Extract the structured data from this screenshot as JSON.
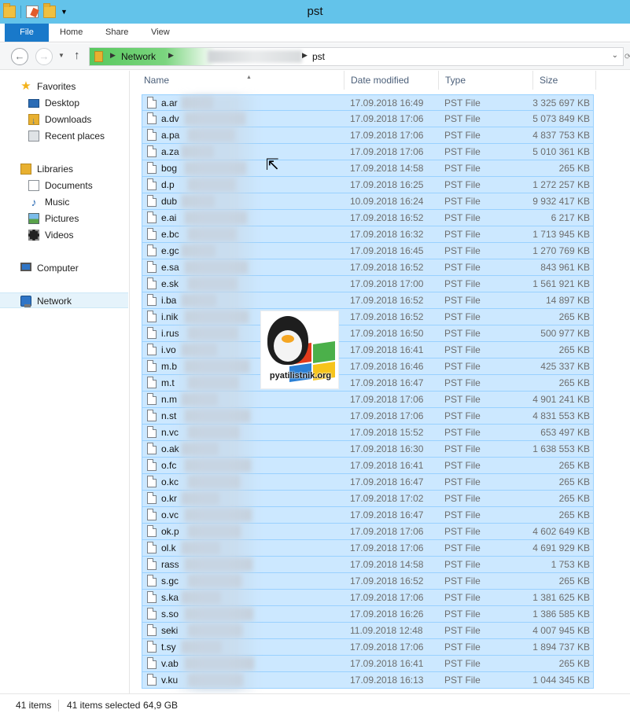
{
  "window": {
    "title": "pst"
  },
  "ribbon": {
    "tabs": [
      "File",
      "Home",
      "Share",
      "View"
    ]
  },
  "address": {
    "segments": [
      "Network",
      "pst"
    ]
  },
  "navpane": {
    "favorites": {
      "label": "Favorites",
      "items": [
        "Desktop",
        "Downloads",
        "Recent places"
      ]
    },
    "libraries": {
      "label": "Libraries",
      "items": [
        "Documents",
        "Music",
        "Pictures",
        "Videos"
      ]
    },
    "computer": "Computer",
    "network": "Network"
  },
  "columns": {
    "name": "Name",
    "date": "Date modified",
    "type": "Type",
    "size": "Size"
  },
  "files": [
    {
      "name": "a.ar",
      "date": "17.09.2018 16:49",
      "type": "PST File",
      "size": "3 325 697 KB"
    },
    {
      "name": "a.dv",
      "date": "17.09.2018 17:06",
      "type": "PST File",
      "size": "5 073 849 KB"
    },
    {
      "name": "a.pa",
      "date": "17.09.2018 17:06",
      "type": "PST File",
      "size": "4 837 753 KB"
    },
    {
      "name": "a.za",
      "date": "17.09.2018 17:06",
      "type": "PST File",
      "size": "5 010 361 KB"
    },
    {
      "name": "bog",
      "date": "17.09.2018 14:58",
      "type": "PST File",
      "size": "265 KB"
    },
    {
      "name": "d.p",
      "date": "17.09.2018 16:25",
      "type": "PST File",
      "size": "1 272 257 KB"
    },
    {
      "name": "dub",
      "date": "10.09.2018 16:24",
      "type": "PST File",
      "size": "9 932 417 KB"
    },
    {
      "name": "e.ai",
      "date": "17.09.2018 16:52",
      "type": "PST File",
      "size": "6 217 KB"
    },
    {
      "name": "e.bc",
      "date": "17.09.2018 16:32",
      "type": "PST File",
      "size": "1 713 945 KB"
    },
    {
      "name": "e.gc",
      "date": "17.09.2018 16:45",
      "type": "PST File",
      "size": "1 270 769 KB"
    },
    {
      "name": "e.sa",
      "date": "17.09.2018 16:52",
      "type": "PST File",
      "size": "843 961 KB"
    },
    {
      "name": "e.sk",
      "date": "17.09.2018 17:00",
      "type": "PST File",
      "size": "1 561 921 KB"
    },
    {
      "name": "i.ba",
      "date": "17.09.2018 16:52",
      "type": "PST File",
      "size": "14 897 KB"
    },
    {
      "name": "i.nik",
      "date": "17.09.2018 16:52",
      "type": "PST File",
      "size": "265 KB"
    },
    {
      "name": "i.rus",
      "date": "17.09.2018 16:50",
      "type": "PST File",
      "size": "500 977 KB"
    },
    {
      "name": "i.vo",
      "date": "17.09.2018 16:41",
      "type": "PST File",
      "size": "265 KB"
    },
    {
      "name": "m.b",
      "date": "17.09.2018 16:46",
      "type": "PST File",
      "size": "425 337 KB"
    },
    {
      "name": "m.t",
      "date": "17.09.2018 16:47",
      "type": "PST File",
      "size": "265 KB"
    },
    {
      "name": "n.m",
      "date": "17.09.2018 17:06",
      "type": "PST File",
      "size": "4 901 241 KB"
    },
    {
      "name": "n.st",
      "date": "17.09.2018 17:06",
      "type": "PST File",
      "size": "4 831 553 KB"
    },
    {
      "name": "n.vc",
      "date": "17.09.2018 15:52",
      "type": "PST File",
      "size": "653 497 KB"
    },
    {
      "name": "o.ak",
      "date": "17.09.2018 16:30",
      "type": "PST File",
      "size": "1 638 553 KB"
    },
    {
      "name": "o.fc",
      "date": "17.09.2018 16:41",
      "type": "PST File",
      "size": "265 KB"
    },
    {
      "name": "o.kc",
      "date": "17.09.2018 16:47",
      "type": "PST File",
      "size": "265 KB"
    },
    {
      "name": "o.kr",
      "date": "17.09.2018 17:02",
      "type": "PST File",
      "size": "265 KB"
    },
    {
      "name": "o.vc",
      "date": "17.09.2018 16:47",
      "type": "PST File",
      "size": "265 KB"
    },
    {
      "name": "ok.p",
      "date": "17.09.2018 17:06",
      "type": "PST File",
      "size": "4 602 649 KB"
    },
    {
      "name": "ol.k",
      "date": "17.09.2018 17:06",
      "type": "PST File",
      "size": "4 691 929 KB"
    },
    {
      "name": "rass",
      "date": "17.09.2018 14:58",
      "type": "PST File",
      "size": "1 753 KB"
    },
    {
      "name": "s.gc",
      "date": "17.09.2018 16:52",
      "type": "PST File",
      "size": "265 KB"
    },
    {
      "name": "s.ka",
      "date": "17.09.2018 17:06",
      "type": "PST File",
      "size": "1 381 625 KB"
    },
    {
      "name": "s.so",
      "date": "17.09.2018 16:26",
      "type": "PST File",
      "size": "1 386 585 KB"
    },
    {
      "name": "seki",
      "date": "11.09.2018 12:48",
      "type": "PST File",
      "size": "4 007 945 KB"
    },
    {
      "name": "t.sy",
      "date": "17.09.2018 17:06",
      "type": "PST File",
      "size": "1 894 737 KB"
    },
    {
      "name": "v.ab",
      "date": "17.09.2018 16:41",
      "type": "PST File",
      "size": "265 KB"
    },
    {
      "name": "v.ku",
      "date": "17.09.2018 16:13",
      "type": "PST File",
      "size": "1 044 345 KB"
    }
  ],
  "watermark": {
    "text": "pyatilistnik.org"
  },
  "status": {
    "count": "41 items",
    "selected": "41 items selected",
    "size": "64,9 GB"
  },
  "colors": {
    "title_bar": "#63c3ea",
    "file_tab": "#1979ca",
    "selection": "#cce8ff",
    "selection_border": "#99d1ff"
  }
}
